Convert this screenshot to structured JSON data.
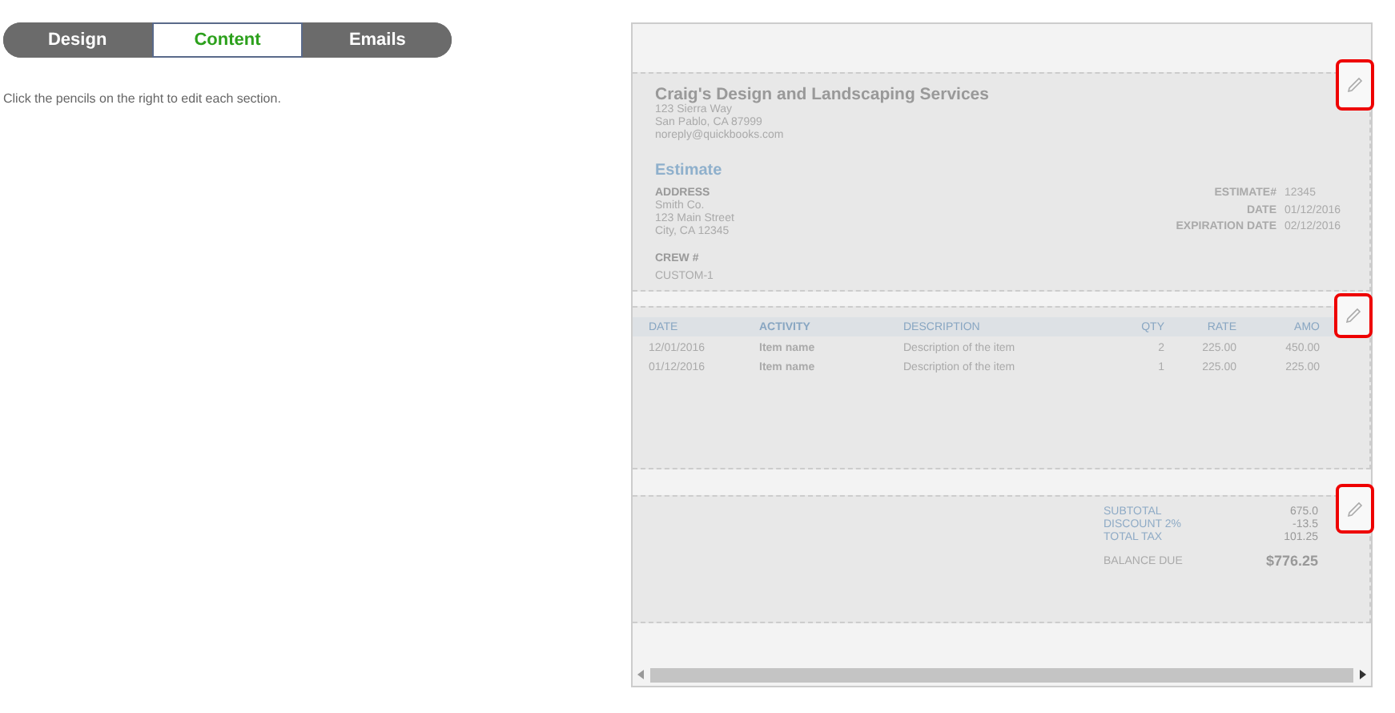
{
  "tabs": [
    {
      "label": "Design",
      "selected": false
    },
    {
      "label": "Content",
      "selected": true
    },
    {
      "label": "Emails",
      "selected": false
    }
  ],
  "instruction": "Click the pencils on the right to edit each section.",
  "preview": {
    "header": {
      "company": "Craig's Design and Landscaping Services",
      "company_lines": [
        "123 Sierra Way",
        "San Pablo, CA 87999",
        "noreply@quickbooks.com"
      ],
      "doc_title": "Estimate",
      "address_label": "ADDRESS",
      "address_lines": [
        "Smith Co.",
        "123 Main Street",
        "City, CA 12345"
      ],
      "fields": [
        {
          "label": "ESTIMATE#",
          "value": "12345"
        },
        {
          "label": "DATE",
          "value": "01/12/2016"
        },
        {
          "label": "EXPIRATION DATE",
          "value": "02/12/2016"
        }
      ],
      "crew_label": "CREW #",
      "crew_value": "CUSTOM-1"
    },
    "table": {
      "columns": [
        "DATE",
        "ACTIVITY",
        "DESCRIPTION",
        "QTY",
        "RATE",
        "AMO"
      ],
      "rows": [
        [
          "12/01/2016",
          "Item name",
          "Description of the item",
          "2",
          "225.00",
          "450.00"
        ],
        [
          "01/12/2016",
          "Item name",
          "Description of the item",
          "1",
          "225.00",
          "225.00"
        ]
      ]
    },
    "totals": [
      {
        "label": "SUBTOTAL",
        "value": "675.0"
      },
      {
        "label": "DISCOUNT 2%",
        "value": "-13.5"
      },
      {
        "label": "TOTAL TAX",
        "value": "101.25"
      }
    ],
    "balance": {
      "label": "BALANCE DUE",
      "value": "$776.25"
    }
  }
}
